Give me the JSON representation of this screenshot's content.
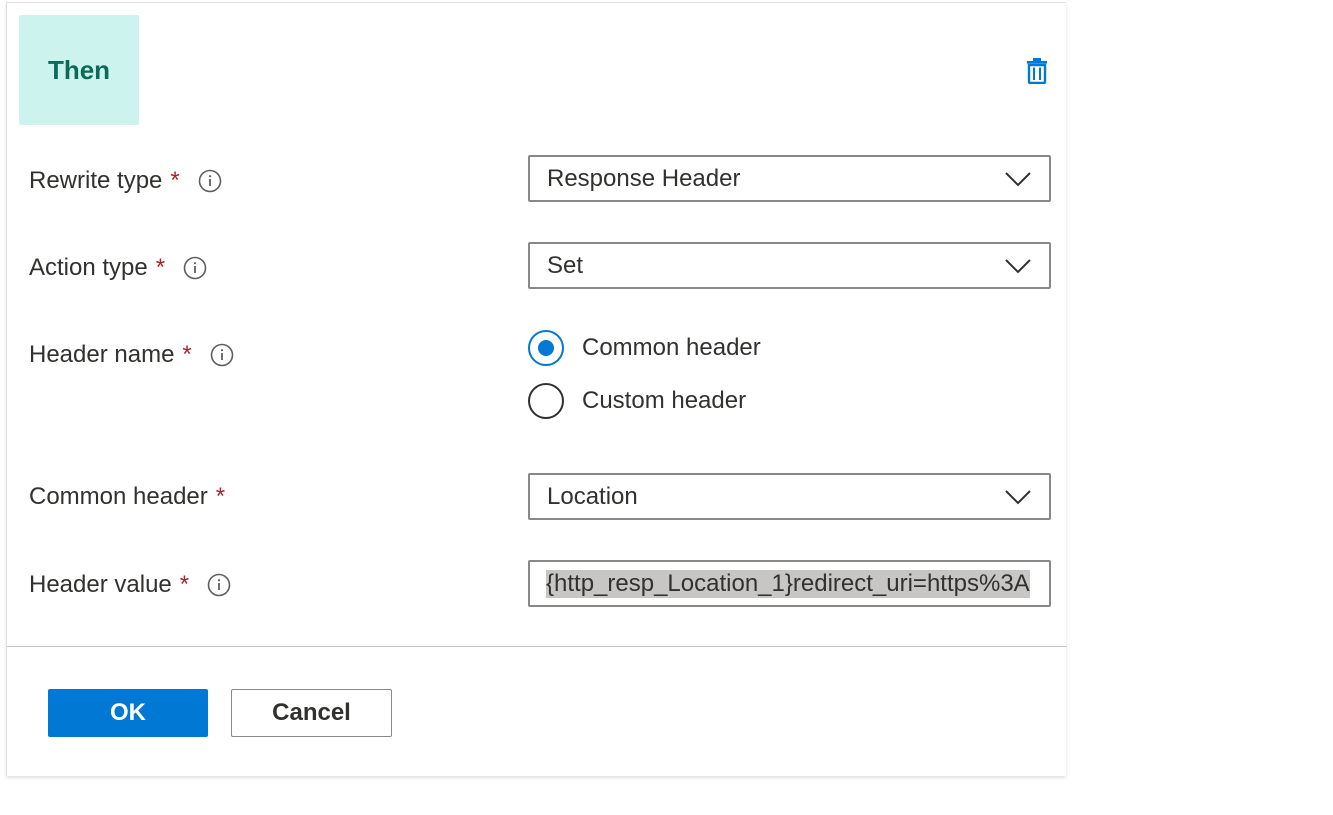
{
  "section": {
    "badge_label": "Then"
  },
  "icons": {
    "delete": "trash-icon",
    "info": "info-icon",
    "chevron": "chevron-down-icon"
  },
  "form": {
    "rewrite_type": {
      "label": "Rewrite type",
      "required_mark": "*",
      "value": "Response Header"
    },
    "action_type": {
      "label": "Action type",
      "required_mark": "*",
      "value": "Set"
    },
    "header_name": {
      "label": "Header name",
      "required_mark": "*",
      "options": [
        {
          "label": "Common header",
          "checked": true
        },
        {
          "label": "Custom header",
          "checked": false
        }
      ]
    },
    "common_header": {
      "label": "Common header",
      "required_mark": "*",
      "value": "Location"
    },
    "header_value": {
      "label": "Header value",
      "required_mark": "*",
      "value": "{http_resp_Location_1}redirect_uri=https%3A"
    }
  },
  "footer": {
    "ok_label": "OK",
    "cancel_label": "Cancel"
  },
  "colors": {
    "accent": "#0078d4",
    "badge_bg": "#cdf3ee",
    "badge_text": "#0b6a5a",
    "required": "#a4262c"
  }
}
